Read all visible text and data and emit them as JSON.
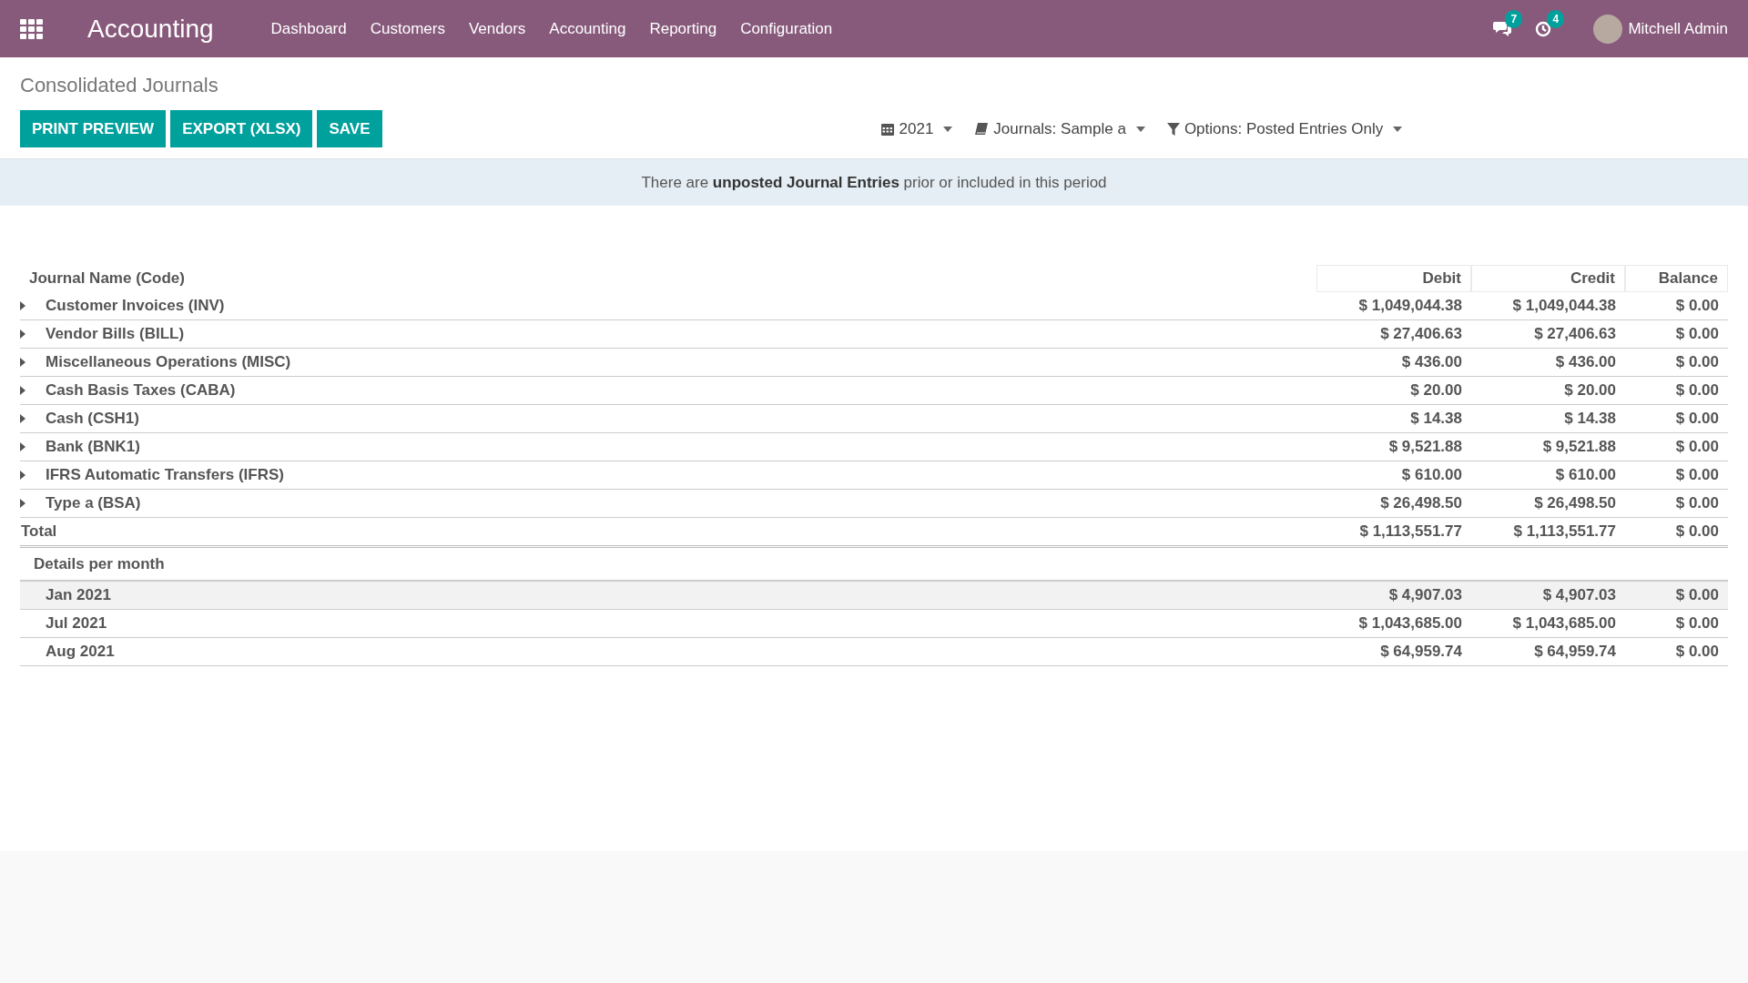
{
  "navbar": {
    "brand": "Accounting",
    "menu": [
      {
        "label": "Dashboard"
      },
      {
        "label": "Customers"
      },
      {
        "label": "Vendors"
      },
      {
        "label": "Accounting"
      },
      {
        "label": "Reporting"
      },
      {
        "label": "Configuration"
      }
    ],
    "messages_badge": "7",
    "activities_badge": "4",
    "user": "Mitchell Admin"
  },
  "page_title": "Consolidated Journals",
  "buttons": [
    {
      "label": "PRINT PREVIEW"
    },
    {
      "label": "EXPORT (XLSX)"
    },
    {
      "label": "SAVE"
    }
  ],
  "filters": [
    {
      "kind": "date",
      "label": "2021"
    },
    {
      "kind": "journals",
      "label": "Journals: Sample a"
    },
    {
      "kind": "options",
      "label": "Options: Posted Entries Only"
    }
  ],
  "notice": "There are **unposted Journal Entries** prior or included in this period",
  "table": {
    "columns": [
      "Journal Name (Code)",
      "Debit",
      "Credit",
      "Balance"
    ],
    "rows": [
      {
        "name": "Customer Invoices (INV)",
        "debit": "$ 1,049,044.38",
        "credit": "$ 1,049,044.38",
        "balance": "$ 0.00",
        "expanded": false
      },
      {
        "name": "Vendor Bills (BILL)",
        "debit": "$ 27,406.63",
        "credit": "$ 27,406.63",
        "balance": "$ 0.00",
        "expanded": false
      },
      {
        "name": "Miscellaneous Operations (MISC)",
        "debit": "$ 436.00",
        "credit": "$ 436.00",
        "balance": "$ 0.00",
        "expanded": false
      },
      {
        "name": "Cash Basis Taxes (CABA)",
        "debit": "$ 20.00",
        "credit": "$ 20.00",
        "balance": "$ 0.00",
        "expanded": false
      },
      {
        "name": "Cash (CSH1)",
        "debit": "$ 14.38",
        "credit": "$ 14.38",
        "balance": "$ 0.00",
        "expanded": false
      },
      {
        "name": "Bank (BNK1)",
        "debit": "$ 9,521.88",
        "credit": "$ 9,521.88",
        "balance": "$ 0.00",
        "expanded": false
      },
      {
        "name": "IFRS Automatic Transfers (IFRS)",
        "debit": "$ 610.00",
        "credit": "$ 610.00",
        "balance": "$ 0.00",
        "expanded": false
      },
      {
        "name": "Type a (BSA)",
        "debit": "$ 26,498.50",
        "credit": "$ 26,498.50",
        "balance": "$ 0.00",
        "expanded": false
      }
    ],
    "total": {
      "name": "Total",
      "debit": "$ 1,113,551.77",
      "credit": "$ 1,113,551.77",
      "balance": "$ 0.00"
    },
    "details_heading": "Details per month",
    "months": [
      {
        "name": "Jan 2021",
        "debit": "$ 4,907.03",
        "credit": "$ 4,907.03",
        "balance": "$ 0.00",
        "selected": true
      },
      {
        "name": "Jul 2021",
        "debit": "$ 1,043,685.00",
        "credit": "$ 1,043,685.00",
        "balance": "$ 0.00",
        "selected": false
      },
      {
        "name": "Aug 2021",
        "debit": "$ 64,959.74",
        "credit": "$ 64,959.74",
        "balance": "$ 0.00",
        "selected": false
      }
    ]
  }
}
